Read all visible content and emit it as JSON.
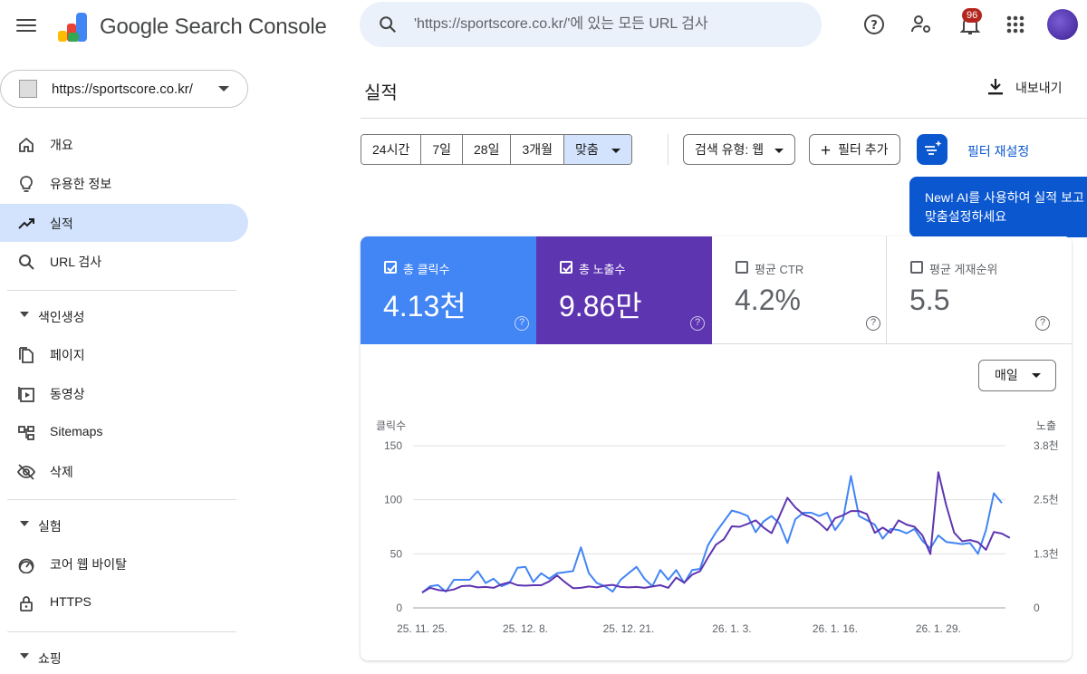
{
  "app": {
    "title": "Google Search Console"
  },
  "search": {
    "placeholder": "'https://sportscore.co.kr/'에 있는 모든 URL 검사"
  },
  "notifications": {
    "count": "96"
  },
  "property": {
    "label": "https://sportscore.co.kr/"
  },
  "sidebar": {
    "items": [
      {
        "label": "개요",
        "icon": "home-icon"
      },
      {
        "label": "유용한 정보",
        "icon": "lightbulb-icon"
      },
      {
        "label": "실적",
        "icon": "trending-up-icon",
        "active": true
      },
      {
        "label": "URL 검사",
        "icon": "search-icon"
      }
    ],
    "sections": [
      {
        "label": "색인생성",
        "items": [
          {
            "label": "페이지",
            "icon": "pages-icon"
          },
          {
            "label": "동영상",
            "icon": "video-icon"
          },
          {
            "label": "Sitemaps",
            "icon": "sitemap-icon"
          },
          {
            "label": "삭제",
            "icon": "eye-off-icon"
          }
        ]
      },
      {
        "label": "실험",
        "items": [
          {
            "label": "코어 웹 바이탈",
            "icon": "gauge-icon"
          },
          {
            "label": "HTTPS",
            "icon": "lock-icon"
          }
        ]
      },
      {
        "label": "쇼핑",
        "items": []
      }
    ]
  },
  "main": {
    "title": "실적",
    "export_label": "내보내기",
    "ranges": [
      "24시간",
      "7일",
      "28일",
      "3개월",
      "맞춤"
    ],
    "selected_range": "맞춤",
    "search_type": "검색 유형: 웹",
    "add_filter": "필터 추가",
    "reset_filters": "필터 재설정",
    "tooltip": {
      "line1": "New! AI를 사용하여 실적 보고",
      "line2": "맞춤설정하세요"
    },
    "granularity": "매일"
  },
  "metrics": [
    {
      "label": "총 클릭수",
      "value": "4.13천",
      "checked": true,
      "color": "#4285f4"
    },
    {
      "label": "총 노출수",
      "value": "9.86만",
      "checked": true,
      "color": "#5e35b1"
    },
    {
      "label": "평균 CTR",
      "value": "4.2%",
      "checked": false
    },
    {
      "label": "평균 게재순위",
      "value": "5.5",
      "checked": false
    }
  ],
  "chart_data": {
    "type": "line",
    "ylabel_left": "클릭수",
    "ylabel_right": "노출",
    "y_ticks_left": [
      "150",
      "100",
      "50",
      "0"
    ],
    "y_ticks_right": [
      "3.8천",
      "2.5천",
      "1.3천",
      "0"
    ],
    "ylim_left": [
      0,
      150
    ],
    "ylim_right": [
      0,
      3800
    ],
    "x_tick_labels": [
      "25. 11. 25.",
      "25. 12. 8.",
      "25. 12. 21.",
      "26. 1. 3.",
      "26. 1. 16.",
      "26. 1. 29."
    ],
    "x_tick_index": [
      0,
      13,
      26,
      39,
      52,
      65
    ],
    "grid": true,
    "series": [
      {
        "name": "총 클릭수",
        "color": "#4285f4",
        "axis": "left",
        "values": [
          14,
          20,
          21,
          15,
          26,
          26,
          26,
          34,
          23,
          27,
          20,
          23,
          37,
          38,
          24,
          32,
          27,
          32,
          33,
          34,
          56,
          32,
          23,
          20,
          15,
          26,
          32,
          38,
          27,
          20,
          35,
          26,
          35,
          23,
          35,
          36,
          58,
          70,
          80,
          90,
          88,
          85,
          70,
          80,
          85,
          78,
          60,
          82,
          88,
          88,
          85,
          88,
          72,
          82,
          122,
          85,
          81,
          77,
          64,
          73,
          72,
          69,
          73,
          62,
          55,
          67,
          61,
          60,
          59,
          60,
          50,
          72,
          106,
          97
        ]
      },
      {
        "name": "총 노출수",
        "color": "#5e35b1",
        "axis": "right",
        "values": [
          360,
          470,
          420,
          400,
          430,
          510,
          520,
          480,
          490,
          470,
          550,
          600,
          530,
          520,
          530,
          530,
          620,
          760,
          600,
          460,
          470,
          500,
          480,
          520,
          540,
          490,
          480,
          490,
          470,
          500,
          530,
          470,
          710,
          590,
          780,
          860,
          1180,
          1480,
          1610,
          1910,
          1900,
          1970,
          2050,
          1880,
          1750,
          2150,
          2580,
          2350,
          2190,
          2120,
          1990,
          1820,
          2100,
          2170,
          2270,
          2270,
          2200,
          1760,
          1880,
          1760,
          2050,
          1950,
          1900,
          1700,
          1260,
          3180,
          2400,
          1760,
          1560,
          1590,
          1540,
          1360,
          1780,
          1740,
          1640
        ]
      }
    ]
  }
}
